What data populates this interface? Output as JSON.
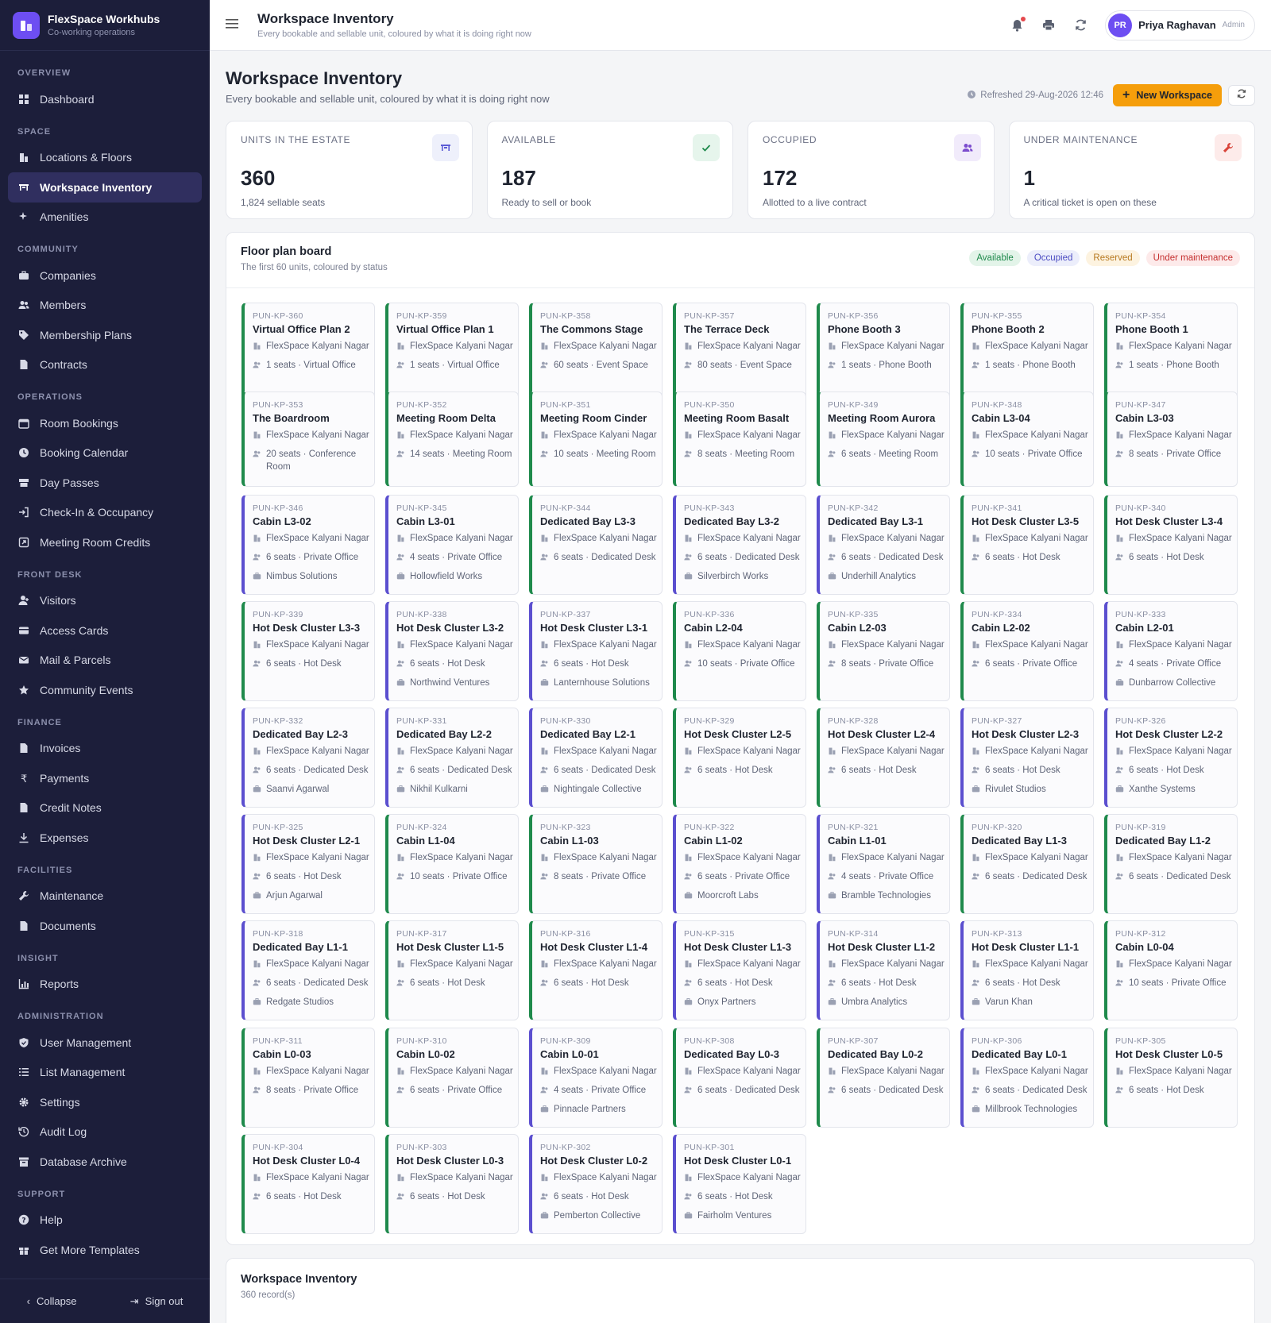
{
  "brand": {
    "name": "FlexSpace Workhubs",
    "subtitle": "Co-working operations"
  },
  "nav": [
    {
      "section": "OVERVIEW",
      "items": [
        {
          "label": "Dashboard",
          "icon": "grid"
        }
      ]
    },
    {
      "section": "SPACE",
      "items": [
        {
          "label": "Locations & Floors",
          "icon": "building"
        },
        {
          "label": "Workspace Inventory",
          "icon": "desk",
          "active": true
        },
        {
          "label": "Amenities",
          "icon": "sparkle"
        }
      ]
    },
    {
      "section": "COMMUNITY",
      "items": [
        {
          "label": "Companies",
          "icon": "briefcase"
        },
        {
          "label": "Members",
          "icon": "users"
        },
        {
          "label": "Membership Plans",
          "icon": "tag"
        },
        {
          "label": "Contracts",
          "icon": "file"
        }
      ]
    },
    {
      "section": "OPERATIONS",
      "items": [
        {
          "label": "Room Bookings",
          "icon": "calendar"
        },
        {
          "label": "Booking Calendar",
          "icon": "clock"
        },
        {
          "label": "Day Passes",
          "icon": "ticket"
        },
        {
          "label": "Check-In & Occupancy",
          "icon": "login"
        },
        {
          "label": "Meeting Room Credits",
          "icon": "credit"
        }
      ]
    },
    {
      "section": "FRONT DESK",
      "items": [
        {
          "label": "Visitors",
          "icon": "user"
        },
        {
          "label": "Access Cards",
          "icon": "card"
        },
        {
          "label": "Mail & Parcels",
          "icon": "mail"
        },
        {
          "label": "Community Events",
          "icon": "star"
        }
      ]
    },
    {
      "section": "FINANCE",
      "items": [
        {
          "label": "Invoices",
          "icon": "file"
        },
        {
          "label": "Payments",
          "icon": "rupee"
        },
        {
          "label": "Credit Notes",
          "icon": "file"
        },
        {
          "label": "Expenses",
          "icon": "download"
        }
      ]
    },
    {
      "section": "FACILITIES",
      "items": [
        {
          "label": "Maintenance",
          "icon": "wrench"
        },
        {
          "label": "Documents",
          "icon": "file"
        }
      ]
    },
    {
      "section": "INSIGHT",
      "items": [
        {
          "label": "Reports",
          "icon": "chart"
        }
      ]
    },
    {
      "section": "ADMINISTRATION",
      "items": [
        {
          "label": "User Management",
          "icon": "shield"
        },
        {
          "label": "List Management",
          "icon": "list"
        },
        {
          "label": "Settings",
          "icon": "gear"
        },
        {
          "label": "Audit Log",
          "icon": "history"
        },
        {
          "label": "Database Archive",
          "icon": "archive"
        }
      ]
    },
    {
      "section": "SUPPORT",
      "items": [
        {
          "label": "Help",
          "icon": "help"
        },
        {
          "label": "Get More Templates",
          "icon": "gift"
        }
      ]
    }
  ],
  "sidebar_footer": {
    "collapse": "Collapse",
    "signout": "Sign out"
  },
  "topbar": {
    "title": "Workspace Inventory",
    "subtitle": "Every bookable and sellable unit, coloured by what it is doing right now",
    "user_initials": "PR",
    "user_name": "Priya Raghavan",
    "user_role": "Admin"
  },
  "page": {
    "title": "Workspace Inventory",
    "subtitle": "Every bookable and sellable unit, coloured by what it is doing right now",
    "refreshed": "Refreshed 29-Aug-2026 12:46",
    "new_button": "New Workspace"
  },
  "stats": [
    {
      "label": "UNITS IN THE ESTATE",
      "value": "360",
      "note": "1,824 sellable seats",
      "icon": "desk-icon",
      "color": "#5b5bd6",
      "bg": "#eef0fb"
    },
    {
      "label": "AVAILABLE",
      "value": "187",
      "note": "Ready to sell or book",
      "icon": "check-icon",
      "color": "#1f8a4c",
      "bg": "#e6f5ec"
    },
    {
      "label": "OCCUPIED",
      "value": "172",
      "note": "Allotted to a live contract",
      "icon": "users-icon",
      "color": "#7c4dce",
      "bg": "#f1ebfb"
    },
    {
      "label": "UNDER MAINTENANCE",
      "value": "1",
      "note": "A critical ticket is open on these",
      "icon": "wrench-icon",
      "color": "#d9443a",
      "bg": "#fdebea"
    }
  ],
  "board": {
    "title": "Floor plan board",
    "subtitle": "The first 60 units, coloured by status",
    "legend": [
      {
        "label": "Available",
        "color": "#1f8a4c",
        "bg": "#e3f4e9"
      },
      {
        "label": "Occupied",
        "color": "#4c4cc2",
        "bg": "#eceefb"
      },
      {
        "label": "Reserved",
        "color": "#b7791f",
        "bg": "#fdf3e0"
      },
      {
        "label": "Under maintenance",
        "color": "#c53030",
        "bg": "#fdeaea"
      }
    ]
  },
  "status_colors": {
    "available": "#1f8a4c",
    "occupied": "#5b4fcf"
  },
  "units": [
    {
      "code": "PUN-KP-360",
      "name": "Virtual Office Plan 2",
      "location": "FlexSpace Kalyani Nagar",
      "detail": "1 seats · Virtual Office",
      "status": "available"
    },
    {
      "code": "PUN-KP-359",
      "name": "Virtual Office Plan 1",
      "location": "FlexSpace Kalyani Nagar",
      "detail": "1 seats · Virtual Office",
      "status": "available"
    },
    {
      "code": "PUN-KP-358",
      "name": "The Commons Stage",
      "location": "FlexSpace Kalyani Nagar",
      "detail": "60 seats · Event Space",
      "status": "available"
    },
    {
      "code": "PUN-KP-357",
      "name": "The Terrace Deck",
      "location": "FlexSpace Kalyani Nagar",
      "detail": "80 seats · Event Space",
      "status": "available"
    },
    {
      "code": "PUN-KP-356",
      "name": "Phone Booth 3",
      "location": "FlexSpace Kalyani Nagar",
      "detail": "1 seats · Phone Booth",
      "status": "available"
    },
    {
      "code": "PUN-KP-355",
      "name": "Phone Booth 2",
      "location": "FlexSpace Kalyani Nagar",
      "detail": "1 seats · Phone Booth",
      "status": "available"
    },
    {
      "code": "PUN-KP-354",
      "name": "Phone Booth 1",
      "location": "FlexSpace Kalyani Nagar",
      "detail": "1 seats · Phone Booth",
      "status": "available"
    },
    {
      "code": "PUN-KP-353",
      "name": "The Boardroom",
      "location": "FlexSpace Kalyani Nagar",
      "detail": "20 seats · Conference Room",
      "status": "available"
    },
    {
      "code": "PUN-KP-352",
      "name": "Meeting Room Delta",
      "location": "FlexSpace Kalyani Nagar",
      "detail": "14 seats · Meeting Room",
      "status": "available"
    },
    {
      "code": "PUN-KP-351",
      "name": "Meeting Room Cinder",
      "location": "FlexSpace Kalyani Nagar",
      "detail": "10 seats · Meeting Room",
      "status": "available"
    },
    {
      "code": "PUN-KP-350",
      "name": "Meeting Room Basalt",
      "location": "FlexSpace Kalyani Nagar",
      "detail": "8 seats · Meeting Room",
      "status": "available"
    },
    {
      "code": "PUN-KP-349",
      "name": "Meeting Room Aurora",
      "location": "FlexSpace Kalyani Nagar",
      "detail": "6 seats · Meeting Room",
      "status": "available"
    },
    {
      "code": "PUN-KP-348",
      "name": "Cabin L3-04",
      "location": "FlexSpace Kalyani Nagar",
      "detail": "10 seats · Private Office",
      "status": "available"
    },
    {
      "code": "PUN-KP-347",
      "name": "Cabin L3-03",
      "location": "FlexSpace Kalyani Nagar",
      "detail": "8 seats · Private Office",
      "status": "available"
    },
    {
      "code": "PUN-KP-346",
      "name": "Cabin L3-02",
      "location": "FlexSpace Kalyani Nagar",
      "detail": "6 seats · Private Office",
      "company": "Nimbus Solutions",
      "status": "occupied"
    },
    {
      "code": "PUN-KP-345",
      "name": "Cabin L3-01",
      "location": "FlexSpace Kalyani Nagar",
      "detail": "4 seats · Private Office",
      "company": "Hollowfield Works",
      "status": "occupied"
    },
    {
      "code": "PUN-KP-344",
      "name": "Dedicated Bay L3-3",
      "location": "FlexSpace Kalyani Nagar",
      "detail": "6 seats · Dedicated Desk",
      "status": "available"
    },
    {
      "code": "PUN-KP-343",
      "name": "Dedicated Bay L3-2",
      "location": "FlexSpace Kalyani Nagar",
      "detail": "6 seats · Dedicated Desk",
      "company": "Silverbirch Works",
      "status": "occupied"
    },
    {
      "code": "PUN-KP-342",
      "name": "Dedicated Bay L3-1",
      "location": "FlexSpace Kalyani Nagar",
      "detail": "6 seats · Dedicated Desk",
      "company": "Underhill Analytics",
      "status": "occupied"
    },
    {
      "code": "PUN-KP-341",
      "name": "Hot Desk Cluster L3-5",
      "location": "FlexSpace Kalyani Nagar",
      "detail": "6 seats · Hot Desk",
      "status": "available"
    },
    {
      "code": "PUN-KP-340",
      "name": "Hot Desk Cluster L3-4",
      "location": "FlexSpace Kalyani Nagar",
      "detail": "6 seats · Hot Desk",
      "status": "available"
    },
    {
      "code": "PUN-KP-339",
      "name": "Hot Desk Cluster L3-3",
      "location": "FlexSpace Kalyani Nagar",
      "detail": "6 seats · Hot Desk",
      "status": "available"
    },
    {
      "code": "PUN-KP-338",
      "name": "Hot Desk Cluster L3-2",
      "location": "FlexSpace Kalyani Nagar",
      "detail": "6 seats · Hot Desk",
      "company": "Northwind Ventures",
      "status": "occupied"
    },
    {
      "code": "PUN-KP-337",
      "name": "Hot Desk Cluster L3-1",
      "location": "FlexSpace Kalyani Nagar",
      "detail": "6 seats · Hot Desk",
      "company": "Lanternhouse Solutions",
      "status": "occupied"
    },
    {
      "code": "PUN-KP-336",
      "name": "Cabin L2-04",
      "location": "FlexSpace Kalyani Nagar",
      "detail": "10 seats · Private Office",
      "status": "available"
    },
    {
      "code": "PUN-KP-335",
      "name": "Cabin L2-03",
      "location": "FlexSpace Kalyani Nagar",
      "detail": "8 seats · Private Office",
      "status": "available"
    },
    {
      "code": "PUN-KP-334",
      "name": "Cabin L2-02",
      "location": "FlexSpace Kalyani Nagar",
      "detail": "6 seats · Private Office",
      "status": "available"
    },
    {
      "code": "PUN-KP-333",
      "name": "Cabin L2-01",
      "location": "FlexSpace Kalyani Nagar",
      "detail": "4 seats · Private Office",
      "company": "Dunbarrow Collective",
      "status": "occupied"
    },
    {
      "code": "PUN-KP-332",
      "name": "Dedicated Bay L2-3",
      "location": "FlexSpace Kalyani Nagar",
      "detail": "6 seats · Dedicated Desk",
      "company": "Saanvi Agarwal",
      "status": "occupied"
    },
    {
      "code": "PUN-KP-331",
      "name": "Dedicated Bay L2-2",
      "location": "FlexSpace Kalyani Nagar",
      "detail": "6 seats · Dedicated Desk",
      "company": "Nikhil Kulkarni",
      "status": "occupied"
    },
    {
      "code": "PUN-KP-330",
      "name": "Dedicated Bay L2-1",
      "location": "FlexSpace Kalyani Nagar",
      "detail": "6 seats · Dedicated Desk",
      "company": "Nightingale Collective",
      "status": "occupied"
    },
    {
      "code": "PUN-KP-329",
      "name": "Hot Desk Cluster L2-5",
      "location": "FlexSpace Kalyani Nagar",
      "detail": "6 seats · Hot Desk",
      "status": "available"
    },
    {
      "code": "PUN-KP-328",
      "name": "Hot Desk Cluster L2-4",
      "location": "FlexSpace Kalyani Nagar",
      "detail": "6 seats · Hot Desk",
      "status": "available"
    },
    {
      "code": "PUN-KP-327",
      "name": "Hot Desk Cluster L2-3",
      "location": "FlexSpace Kalyani Nagar",
      "detail": "6 seats · Hot Desk",
      "company": "Rivulet Studios",
      "status": "occupied"
    },
    {
      "code": "PUN-KP-326",
      "name": "Hot Desk Cluster L2-2",
      "location": "FlexSpace Kalyani Nagar",
      "detail": "6 seats · Hot Desk",
      "company": "Xanthe Systems",
      "status": "occupied"
    },
    {
      "code": "PUN-KP-325",
      "name": "Hot Desk Cluster L2-1",
      "location": "FlexSpace Kalyani Nagar",
      "detail": "6 seats · Hot Desk",
      "company": "Arjun Agarwal",
      "status": "occupied"
    },
    {
      "code": "PUN-KP-324",
      "name": "Cabin L1-04",
      "location": "FlexSpace Kalyani Nagar",
      "detail": "10 seats · Private Office",
      "status": "available"
    },
    {
      "code": "PUN-KP-323",
      "name": "Cabin L1-03",
      "location": "FlexSpace Kalyani Nagar",
      "detail": "8 seats · Private Office",
      "status": "available"
    },
    {
      "code": "PUN-KP-322",
      "name": "Cabin L1-02",
      "location": "FlexSpace Kalyani Nagar",
      "detail": "6 seats · Private Office",
      "company": "Moorcroft Labs",
      "status": "occupied"
    },
    {
      "code": "PUN-KP-321",
      "name": "Cabin L1-01",
      "location": "FlexSpace Kalyani Nagar",
      "detail": "4 seats · Private Office",
      "company": "Bramble Technologies",
      "status": "occupied"
    },
    {
      "code": "PUN-KP-320",
      "name": "Dedicated Bay L1-3",
      "location": "FlexSpace Kalyani Nagar",
      "detail": "6 seats · Dedicated Desk",
      "status": "available"
    },
    {
      "code": "PUN-KP-319",
      "name": "Dedicated Bay L1-2",
      "location": "FlexSpace Kalyani Nagar",
      "detail": "6 seats · Dedicated Desk",
      "status": "available"
    },
    {
      "code": "PUN-KP-318",
      "name": "Dedicated Bay L1-1",
      "location": "FlexSpace Kalyani Nagar",
      "detail": "6 seats · Dedicated Desk",
      "company": "Redgate Studios",
      "status": "occupied"
    },
    {
      "code": "PUN-KP-317",
      "name": "Hot Desk Cluster L1-5",
      "location": "FlexSpace Kalyani Nagar",
      "detail": "6 seats · Hot Desk",
      "status": "available"
    },
    {
      "code": "PUN-KP-316",
      "name": "Hot Desk Cluster L1-4",
      "location": "FlexSpace Kalyani Nagar",
      "detail": "6 seats · Hot Desk",
      "status": "available"
    },
    {
      "code": "PUN-KP-315",
      "name": "Hot Desk Cluster L1-3",
      "location": "FlexSpace Kalyani Nagar",
      "detail": "6 seats · Hot Desk",
      "company": "Onyx Partners",
      "status": "occupied"
    },
    {
      "code": "PUN-KP-314",
      "name": "Hot Desk Cluster L1-2",
      "location": "FlexSpace Kalyani Nagar",
      "detail": "6 seats · Hot Desk",
      "company": "Umbra Analytics",
      "status": "occupied"
    },
    {
      "code": "PUN-KP-313",
      "name": "Hot Desk Cluster L1-1",
      "location": "FlexSpace Kalyani Nagar",
      "detail": "6 seats · Hot Desk",
      "company": "Varun Khan",
      "status": "occupied"
    },
    {
      "code": "PUN-KP-312",
      "name": "Cabin L0-04",
      "location": "FlexSpace Kalyani Nagar",
      "detail": "10 seats · Private Office",
      "status": "available"
    },
    {
      "code": "PUN-KP-311",
      "name": "Cabin L0-03",
      "location": "FlexSpace Kalyani Nagar",
      "detail": "8 seats · Private Office",
      "status": "available"
    },
    {
      "code": "PUN-KP-310",
      "name": "Cabin L0-02",
      "location": "FlexSpace Kalyani Nagar",
      "detail": "6 seats · Private Office",
      "status": "available"
    },
    {
      "code": "PUN-KP-309",
      "name": "Cabin L0-01",
      "location": "FlexSpace Kalyani Nagar",
      "detail": "4 seats · Private Office",
      "company": "Pinnacle Partners",
      "status": "occupied"
    },
    {
      "code": "PUN-KP-308",
      "name": "Dedicated Bay L0-3",
      "location": "FlexSpace Kalyani Nagar",
      "detail": "6 seats · Dedicated Desk",
      "status": "available"
    },
    {
      "code": "PUN-KP-307",
      "name": "Dedicated Bay L0-2",
      "location": "FlexSpace Kalyani Nagar",
      "detail": "6 seats · Dedicated Desk",
      "status": "available"
    },
    {
      "code": "PUN-KP-306",
      "name": "Dedicated Bay L0-1",
      "location": "FlexSpace Kalyani Nagar",
      "detail": "6 seats · Dedicated Desk",
      "company": "Millbrook Technologies",
      "status": "occupied"
    },
    {
      "code": "PUN-KP-305",
      "name": "Hot Desk Cluster L0-5",
      "location": "FlexSpace Kalyani Nagar",
      "detail": "6 seats · Hot Desk",
      "status": "available"
    },
    {
      "code": "PUN-KP-304",
      "name": "Hot Desk Cluster L0-4",
      "location": "FlexSpace Kalyani Nagar",
      "detail": "6 seats · Hot Desk",
      "status": "available"
    },
    {
      "code": "PUN-KP-303",
      "name": "Hot Desk Cluster L0-3",
      "location": "FlexSpace Kalyani Nagar",
      "detail": "6 seats · Hot Desk",
      "status": "available"
    },
    {
      "code": "PUN-KP-302",
      "name": "Hot Desk Cluster L0-2",
      "location": "FlexSpace Kalyani Nagar",
      "detail": "6 seats · Hot Desk",
      "company": "Pemberton Collective",
      "status": "occupied"
    },
    {
      "code": "PUN-KP-301",
      "name": "Hot Desk Cluster L0-1",
      "location": "FlexSpace Kalyani Nagar",
      "detail": "6 seats · Hot Desk",
      "company": "Fairholm Ventures",
      "status": "occupied"
    }
  ],
  "table": {
    "title": "Workspace Inventory",
    "subtitle": "360 record(s)"
  }
}
